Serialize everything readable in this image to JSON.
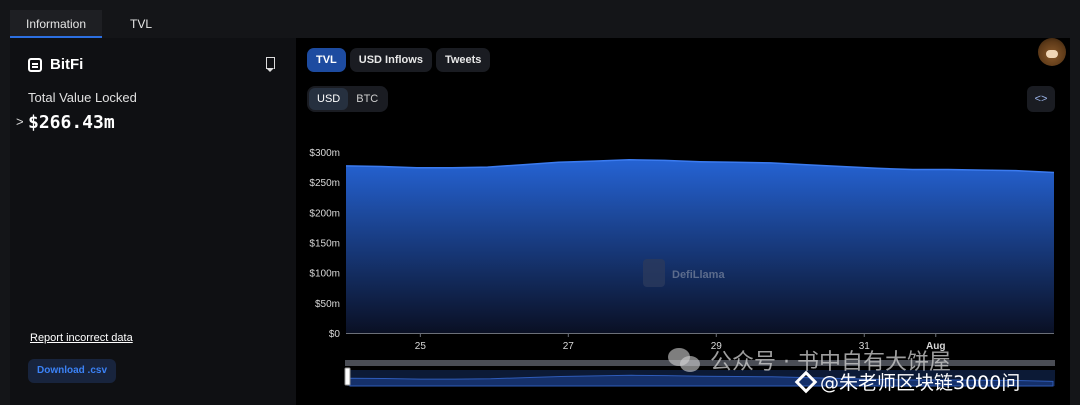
{
  "tabs": [
    {
      "label": "Information",
      "active": true
    },
    {
      "label": "TVL",
      "active": false
    }
  ],
  "protocol": {
    "name": "BitFi",
    "tvl_label": "Total Value Locked",
    "tvl_value": "$266.43m",
    "expand_chevron": ">",
    "report_link": "Report incorrect data",
    "download_button": "Download .csv"
  },
  "chart_controls": {
    "metric_tabs": [
      {
        "label": "TVL",
        "active": true
      },
      {
        "label": "USD Inflows",
        "active": false
      },
      {
        "label": "Tweets",
        "active": false
      }
    ],
    "currency": [
      {
        "label": "USD",
        "active": true
      },
      {
        "label": "BTC",
        "active": false
      }
    ],
    "embed_icon": "<>"
  },
  "watermark_chart": "DefiLlama",
  "overlay_watermarks": {
    "line1": "公众号 · 书中自有大饼屋",
    "line2": "@朱老师区块链3000问"
  },
  "colors": {
    "accent": "#1d4ba0",
    "area_top": "#2563d4",
    "area_bottom": "#0a1024",
    "download_text": "#3b82f6"
  },
  "chart_data": {
    "type": "area",
    "series": [
      {
        "values": [
          277,
          276,
          274,
          274,
          275,
          279,
          283,
          285,
          287,
          286,
          284,
          283,
          282,
          279,
          276,
          273,
          271,
          271,
          270,
          269,
          266
        ]
      }
    ],
    "x_ticks": [
      "25",
      "27",
      "29",
      "31",
      "Aug"
    ],
    "y_ticks": [
      "$0",
      "$50m",
      "$100m",
      "$150m",
      "$200m",
      "$250m",
      "$300m"
    ],
    "ylim": [
      0,
      300
    ]
  }
}
